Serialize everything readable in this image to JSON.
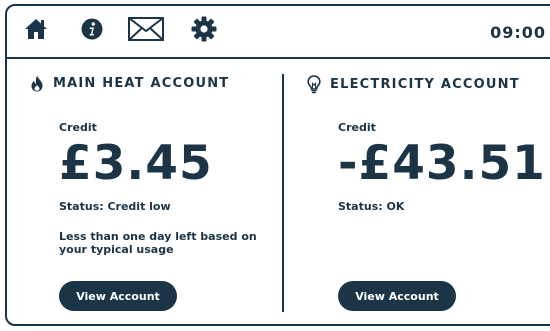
{
  "header": {
    "time": "09:00",
    "icons": [
      "home-icon",
      "info-icon",
      "mail-icon",
      "gear-icon"
    ]
  },
  "heat_account": {
    "icon": "flame-icon",
    "title": "MAIN HEAT ACCOUNT",
    "credit_label": "Credit",
    "amount": "£3.45",
    "status": "Status: Credit low",
    "note": "Less than one day left based on your typical usage",
    "button_label": "View Account"
  },
  "electricity_account": {
    "icon": "lightbulb-icon",
    "title": "ELECTRICITY ACCOUNT",
    "credit_label": "Credit",
    "amount": "-£43.51",
    "status": "Status: OK",
    "button_label": "View Account"
  },
  "colors": {
    "primary": "#1b3446",
    "background": "#ffffff"
  }
}
